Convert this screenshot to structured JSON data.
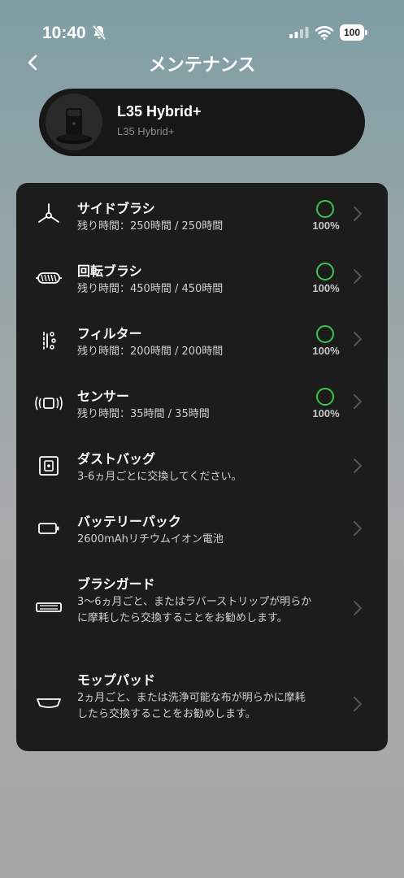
{
  "status_bar": {
    "time": "10:40",
    "battery": "100"
  },
  "header": {
    "title": "メンテナンス"
  },
  "device": {
    "name": "L35 Hybrid+",
    "model": "L35 Hybrid+"
  },
  "items": [
    {
      "title": "サイドブラシ",
      "desc": "残り時間：250時間 / 250時間",
      "percent": "100%",
      "icon": "side-brush-icon"
    },
    {
      "title": "回転ブラシ",
      "desc": "残り時間：450時間 / 450時間",
      "percent": "100%",
      "icon": "main-brush-icon"
    },
    {
      "title": "フィルター",
      "desc": "残り時間：200時間 / 200時間",
      "percent": "100%",
      "icon": "filter-icon"
    },
    {
      "title": "センサー",
      "desc": "残り時間：35時間 / 35時間",
      "percent": "100%",
      "icon": "sensor-icon"
    },
    {
      "title": "ダストバッグ",
      "desc": "3-6ヵ月ごとに交換してください。",
      "icon": "dust-bag-icon"
    },
    {
      "title": "バッテリーパック",
      "desc": "2600mAhリチウムイオン電池",
      "icon": "battery-pack-icon"
    },
    {
      "title": "ブラシガード",
      "desc": "3〜6ヵ月ごと、またはラバーストリップが明らかに摩耗したら交換することをお勧めします。",
      "icon": "brush-guard-icon"
    },
    {
      "title": "モップパッド",
      "desc": "2ヵ月ごと、または洗浄可能な布が明らかに摩耗したら交換することをお勧めします。",
      "icon": "mop-pad-icon"
    }
  ],
  "colors": {
    "ok_ring": "#3cc44b",
    "panel": "#1c1c1c"
  }
}
